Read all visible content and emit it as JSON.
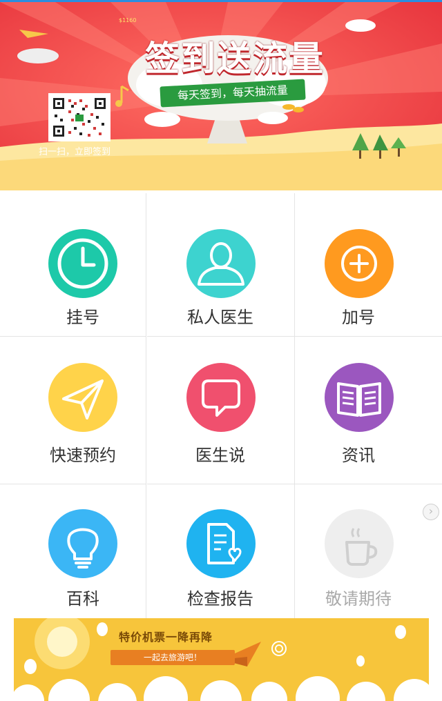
{
  "banner": {
    "title": "签到送流量",
    "ribbon": "每天签到，每天抽流量",
    "qr_caption": "扫一扫，立即签到",
    "price_tag": "$1160"
  },
  "grid": {
    "items": [
      {
        "label": "挂号",
        "icon": "clock-icon",
        "color": "#1dc9a9"
      },
      {
        "label": "私人医生",
        "icon": "person-icon",
        "color": "#3dd3cf"
      },
      {
        "label": "加号",
        "icon": "plus-icon",
        "color": "#ff9a1f"
      },
      {
        "label": "快速预约",
        "icon": "paper-plane-icon",
        "color": "#ffd34a"
      },
      {
        "label": "医生说",
        "icon": "speech-bubble-icon",
        "color": "#f0506e"
      },
      {
        "label": "资讯",
        "icon": "book-icon",
        "color": "#9b57bf"
      },
      {
        "label": "百科",
        "icon": "lightbulb-icon",
        "color": "#3bb6f5"
      },
      {
        "label": "检查报告",
        "icon": "report-icon",
        "color": "#1fb3f0"
      },
      {
        "label": "敬请期待",
        "icon": "coffee-cup-icon",
        "color": "#eeeeee"
      }
    ]
  },
  "promo": {
    "title": "特价机票一降再降",
    "subtitle": "一起去旅游吧！"
  }
}
